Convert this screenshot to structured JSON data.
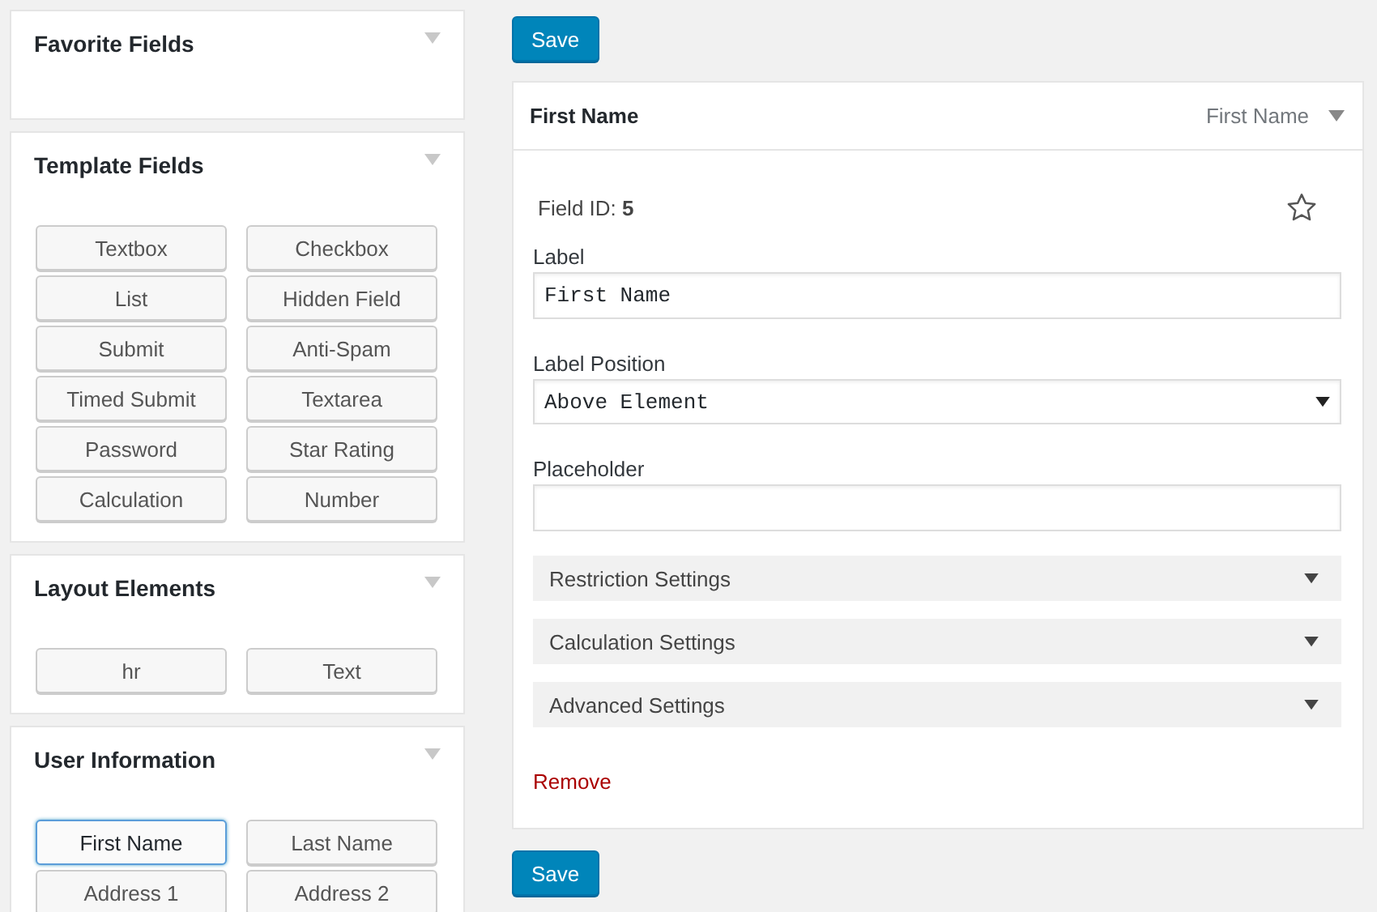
{
  "groups": [
    {
      "title": "Favorite Fields"
    },
    {
      "title": "Template Fields",
      "buttons": [
        {
          "label": "Textbox",
          "selected": false
        },
        {
          "label": "Checkbox",
          "selected": false
        },
        {
          "label": "List",
          "selected": false
        },
        {
          "label": "Hidden Field",
          "selected": false
        },
        {
          "label": "Submit",
          "selected": false
        },
        {
          "label": "Anti-Spam",
          "selected": false
        },
        {
          "label": "Timed Submit",
          "selected": false
        },
        {
          "label": "Textarea",
          "selected": false
        },
        {
          "label": "Password",
          "selected": false
        },
        {
          "label": "Star Rating",
          "selected": false
        },
        {
          "label": "Calculation",
          "selected": false
        },
        {
          "label": "Number",
          "selected": false
        }
      ]
    },
    {
      "title": "Layout Elements",
      "buttons": [
        {
          "label": "hr",
          "selected": false
        },
        {
          "label": "Text",
          "selected": false
        }
      ]
    },
    {
      "title": "User Information",
      "buttons": [
        {
          "label": "First Name",
          "selected": true
        },
        {
          "label": "Last Name",
          "selected": false
        },
        {
          "label": "Address 1",
          "selected": false
        },
        {
          "label": "Address 2",
          "selected": false
        }
      ]
    }
  ],
  "save_top": "Save",
  "editor": {
    "title": "First Name",
    "type": "First Name",
    "field_id": "Field ID: **5**",
    "favorite": false,
    "label": {
      "label": "Label",
      "value": "First Name"
    },
    "label_position": {
      "label": "Label Position",
      "value": "Above Element"
    },
    "placeholder": {
      "label": "Placeholder"
    },
    "sections": [
      {
        "label": "Restriction Settings",
        "expanded": false
      },
      {
        "label": "Calculation Settings",
        "expanded": false
      },
      {
        "label": "Advanced Settings",
        "expanded": false
      }
    ],
    "remove": "Remove"
  },
  "save_bottom": "Save"
}
